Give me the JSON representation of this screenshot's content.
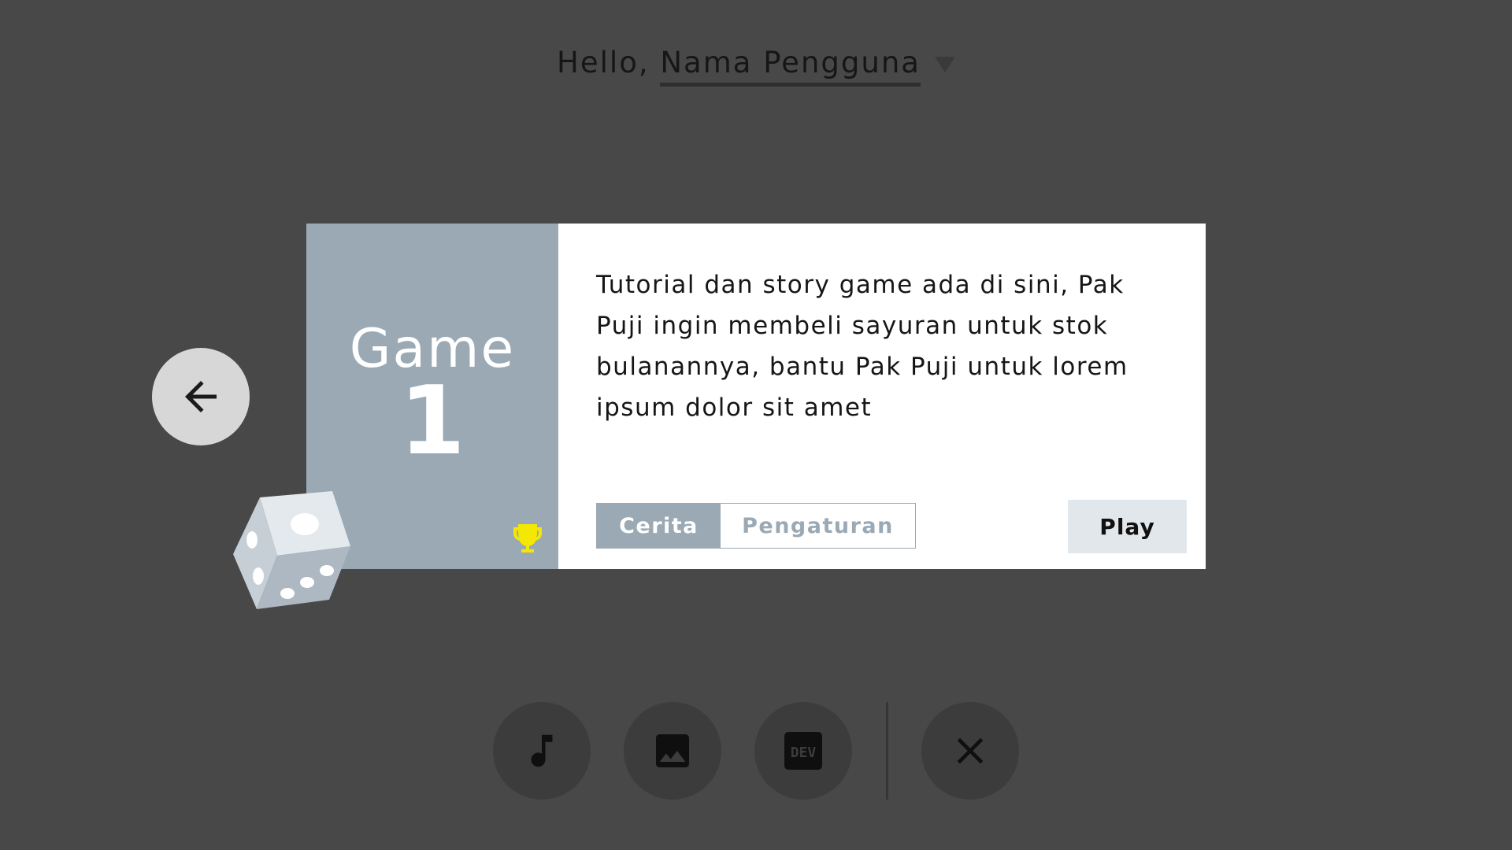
{
  "header": {
    "greeting_prefix": "Hello,",
    "user_name": "Nama Pengguna",
    "dropdown_icon": "caret-down-icon"
  },
  "card": {
    "game_label": "Game",
    "game_number": "1",
    "trophy_icon": "trophy-icon",
    "description": "Tutorial dan story game ada di sini, Pak Puji ingin membeli sayuran untuk stok bulanannya, bantu Pak Puji untuk lorem ipsum dolor sit amet",
    "tabs": [
      {
        "label": "Cerita",
        "active": true
      },
      {
        "label": "Pengaturan",
        "active": false
      }
    ],
    "play_label": "Play"
  },
  "navigation": {
    "back_icon": "arrow-left-icon"
  },
  "decoration": {
    "dice_icon": "dice-icon"
  },
  "bottom_bar": {
    "buttons": [
      {
        "icon": "music-note-icon"
      },
      {
        "icon": "image-icon"
      },
      {
        "icon": "dev-icon",
        "label": "DEV"
      },
      {
        "icon": "close-icon"
      }
    ]
  },
  "colors": {
    "background": "#484848",
    "card_accent": "#9aa9b4",
    "trophy": "#f5e800",
    "play_button": "#e2e7ec"
  }
}
